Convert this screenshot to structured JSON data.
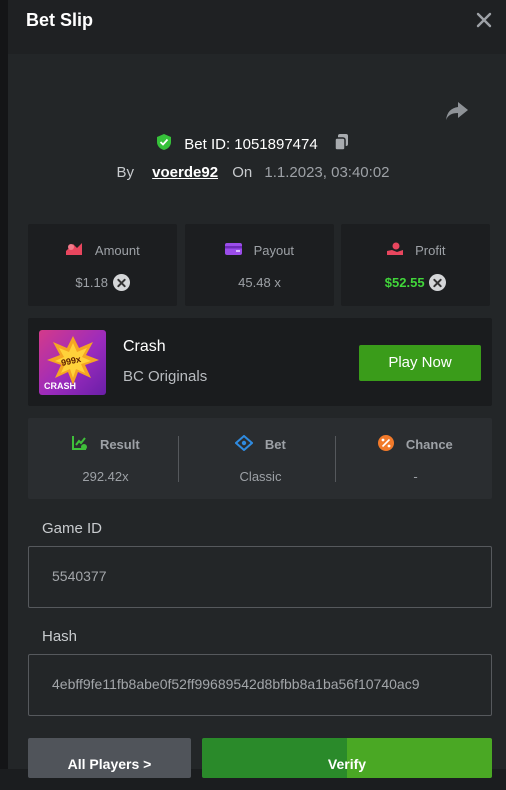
{
  "header": {
    "title": "Bet Slip"
  },
  "bet": {
    "id_label": "Bet ID: 1051897474",
    "by_label": "By",
    "username": "voerde92",
    "on_label": "On",
    "datetime": "1.1.2023, 03:40:02"
  },
  "stats": [
    {
      "label": "Amount",
      "value": "$1.18",
      "color": "#9da1a6",
      "icon": "coins-icon"
    },
    {
      "label": "Payout",
      "value": "45.48 x",
      "color": "#9da1a6",
      "icon": "wallet-icon"
    },
    {
      "label": "Profit",
      "value": "$52.55",
      "color": "#41d63a",
      "icon": "hand-coin-icon"
    }
  ],
  "game": {
    "name": "Crash",
    "provider": "BC Originals",
    "thumb_multiplier": "999x",
    "thumb_label": "CRASH",
    "play_label": "Play Now"
  },
  "result": [
    {
      "label": "Result",
      "value": "292.42x",
      "color": "#3fbf3a",
      "icon": "chart-check-icon"
    },
    {
      "label": "Bet",
      "value": "Classic",
      "color": "#2f8be0",
      "icon": "ticket-icon"
    },
    {
      "label": "Chance",
      "value": "-",
      "color": "#f27a2a",
      "icon": "percent-icon"
    }
  ],
  "fields": {
    "game_id_label": "Game ID",
    "game_id_value": "5540377",
    "hash_label": "Hash",
    "hash_value": "4ebff9fe11fb8abe0f52ff99689542d8bfbb8a1ba56f10740ac9"
  },
  "actions": {
    "all_players": "All Players >",
    "verify": "Verify"
  },
  "colors": {
    "accent_green": "#3a9c1a",
    "profit_green": "#41d63a"
  }
}
